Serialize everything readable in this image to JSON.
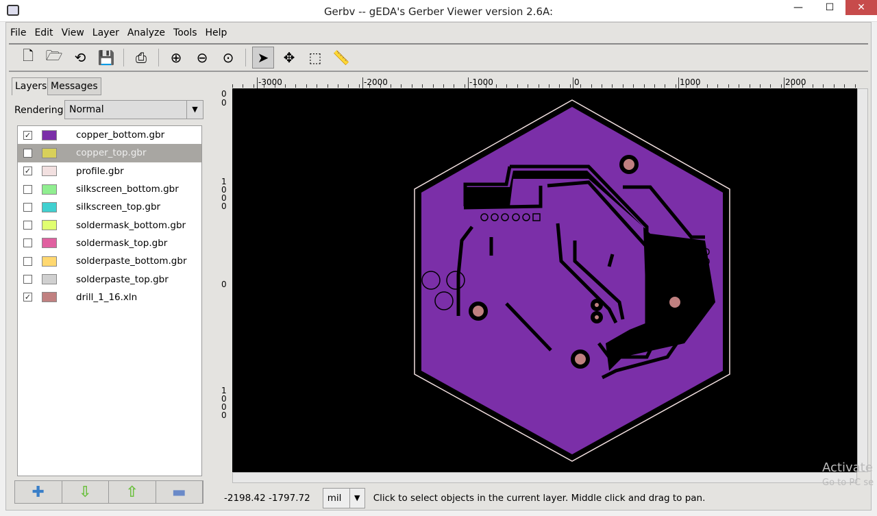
{
  "window": {
    "title": "Gerbv -- gEDA's Gerber Viewer version 2.6A:",
    "minimize": "—",
    "maximize": "☐",
    "close": "✕"
  },
  "menu": [
    "File",
    "Edit",
    "View",
    "Layer",
    "Analyze",
    "Tools",
    "Help"
  ],
  "toolbar": [
    {
      "icon": "new-file-icon",
      "glyph": "🗋"
    },
    {
      "icon": "open-folder-icon",
      "glyph": "🗁"
    },
    {
      "icon": "revert-icon",
      "glyph": "⟲"
    },
    {
      "icon": "save-icon",
      "glyph": "💾"
    },
    {
      "icon": "print-icon",
      "glyph": "⎙"
    },
    {
      "icon": "zoom-in-icon",
      "glyph": "⊕"
    },
    {
      "icon": "zoom-out-icon",
      "glyph": "⊖"
    },
    {
      "icon": "zoom-fit-icon",
      "glyph": "⊙"
    },
    {
      "icon": "pointer-icon",
      "glyph": "➤"
    },
    {
      "icon": "pan-icon",
      "glyph": "✥"
    },
    {
      "icon": "zoom-region-icon",
      "glyph": "⬚"
    },
    {
      "icon": "measure-icon",
      "glyph": "📏"
    }
  ],
  "tabs": {
    "layers": "Layers",
    "messages": "Messages"
  },
  "rendering": {
    "label": "Rendering:",
    "value": "Normal"
  },
  "layers": [
    {
      "name": "copper_bottom.gbr",
      "color": "#7b2fa8",
      "checked": true
    },
    {
      "name": "copper_top.gbr",
      "color": "#d8d05a",
      "checked": false,
      "selected": true
    },
    {
      "name": "profile.gbr",
      "color": "#f2e0e0",
      "checked": true
    },
    {
      "name": "silkscreen_bottom.gbr",
      "color": "#90ee90",
      "checked": false
    },
    {
      "name": "silkscreen_top.gbr",
      "color": "#40d0d0",
      "checked": false
    },
    {
      "name": "soldermask_bottom.gbr",
      "color": "#e0ff70",
      "checked": false
    },
    {
      "name": "soldermask_top.gbr",
      "color": "#e060a0",
      "checked": false
    },
    {
      "name": "solderpaste_bottom.gbr",
      "color": "#ffd870",
      "checked": false
    },
    {
      "name": "solderpaste_top.gbr",
      "color": "#d0d0d0",
      "checked": false
    },
    {
      "name": "drill_1_16.xln",
      "color": "#c08080",
      "checked": true
    }
  ],
  "layer_buttons": [
    {
      "icon": "add-layer-icon",
      "glyph": "✚",
      "color": "#3a7fc8"
    },
    {
      "icon": "move-down-icon",
      "glyph": "⇩",
      "color": "#6cc040"
    },
    {
      "icon": "move-up-icon",
      "glyph": "⇧",
      "color": "#6cc040"
    },
    {
      "icon": "remove-layer-icon",
      "glyph": "▬",
      "color": "#6a8ac8"
    }
  ],
  "ruler": {
    "x_labels": [
      "-3000",
      "-2000",
      "-1000",
      "0",
      "1000",
      "2000"
    ],
    "y_labels": [
      "0",
      "0",
      "1000",
      "0",
      "1000"
    ]
  },
  "status": {
    "coords": "-2198.42 -1797.72",
    "unit": "mil",
    "message": "Click to select objects in the current layer. Middle click and drag to pan."
  },
  "watermark": {
    "line1": "Activate",
    "line2": "Go to PC se"
  },
  "colors": {
    "board": "#7b2fa8",
    "pad": "#c08080",
    "outline": "#f2e0e0",
    "background": "#000000"
  }
}
